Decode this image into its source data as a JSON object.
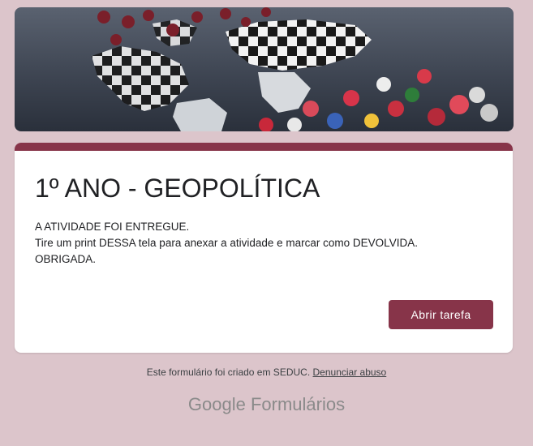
{
  "banner": {
    "image": "world-map-chess-pieces"
  },
  "form": {
    "title": "1º ANO - GEOPOLÍTICA",
    "message_lines": [
      "A ATIVIDADE FOI ENTREGUE.",
      "Tire um print DESSA tela para anexar a atividade e marcar como DEVOLVIDA.",
      "OBRIGADA."
    ],
    "open_task_label": "Abrir tarefa"
  },
  "footer": {
    "created_text": "Este formulário foi criado em SEDUC.",
    "report_link": "Denunciar abuso"
  },
  "brand": {
    "google": "Google",
    "product": "Formulários"
  },
  "colors": {
    "accent": "#873449",
    "background": "#dcc5cb"
  }
}
